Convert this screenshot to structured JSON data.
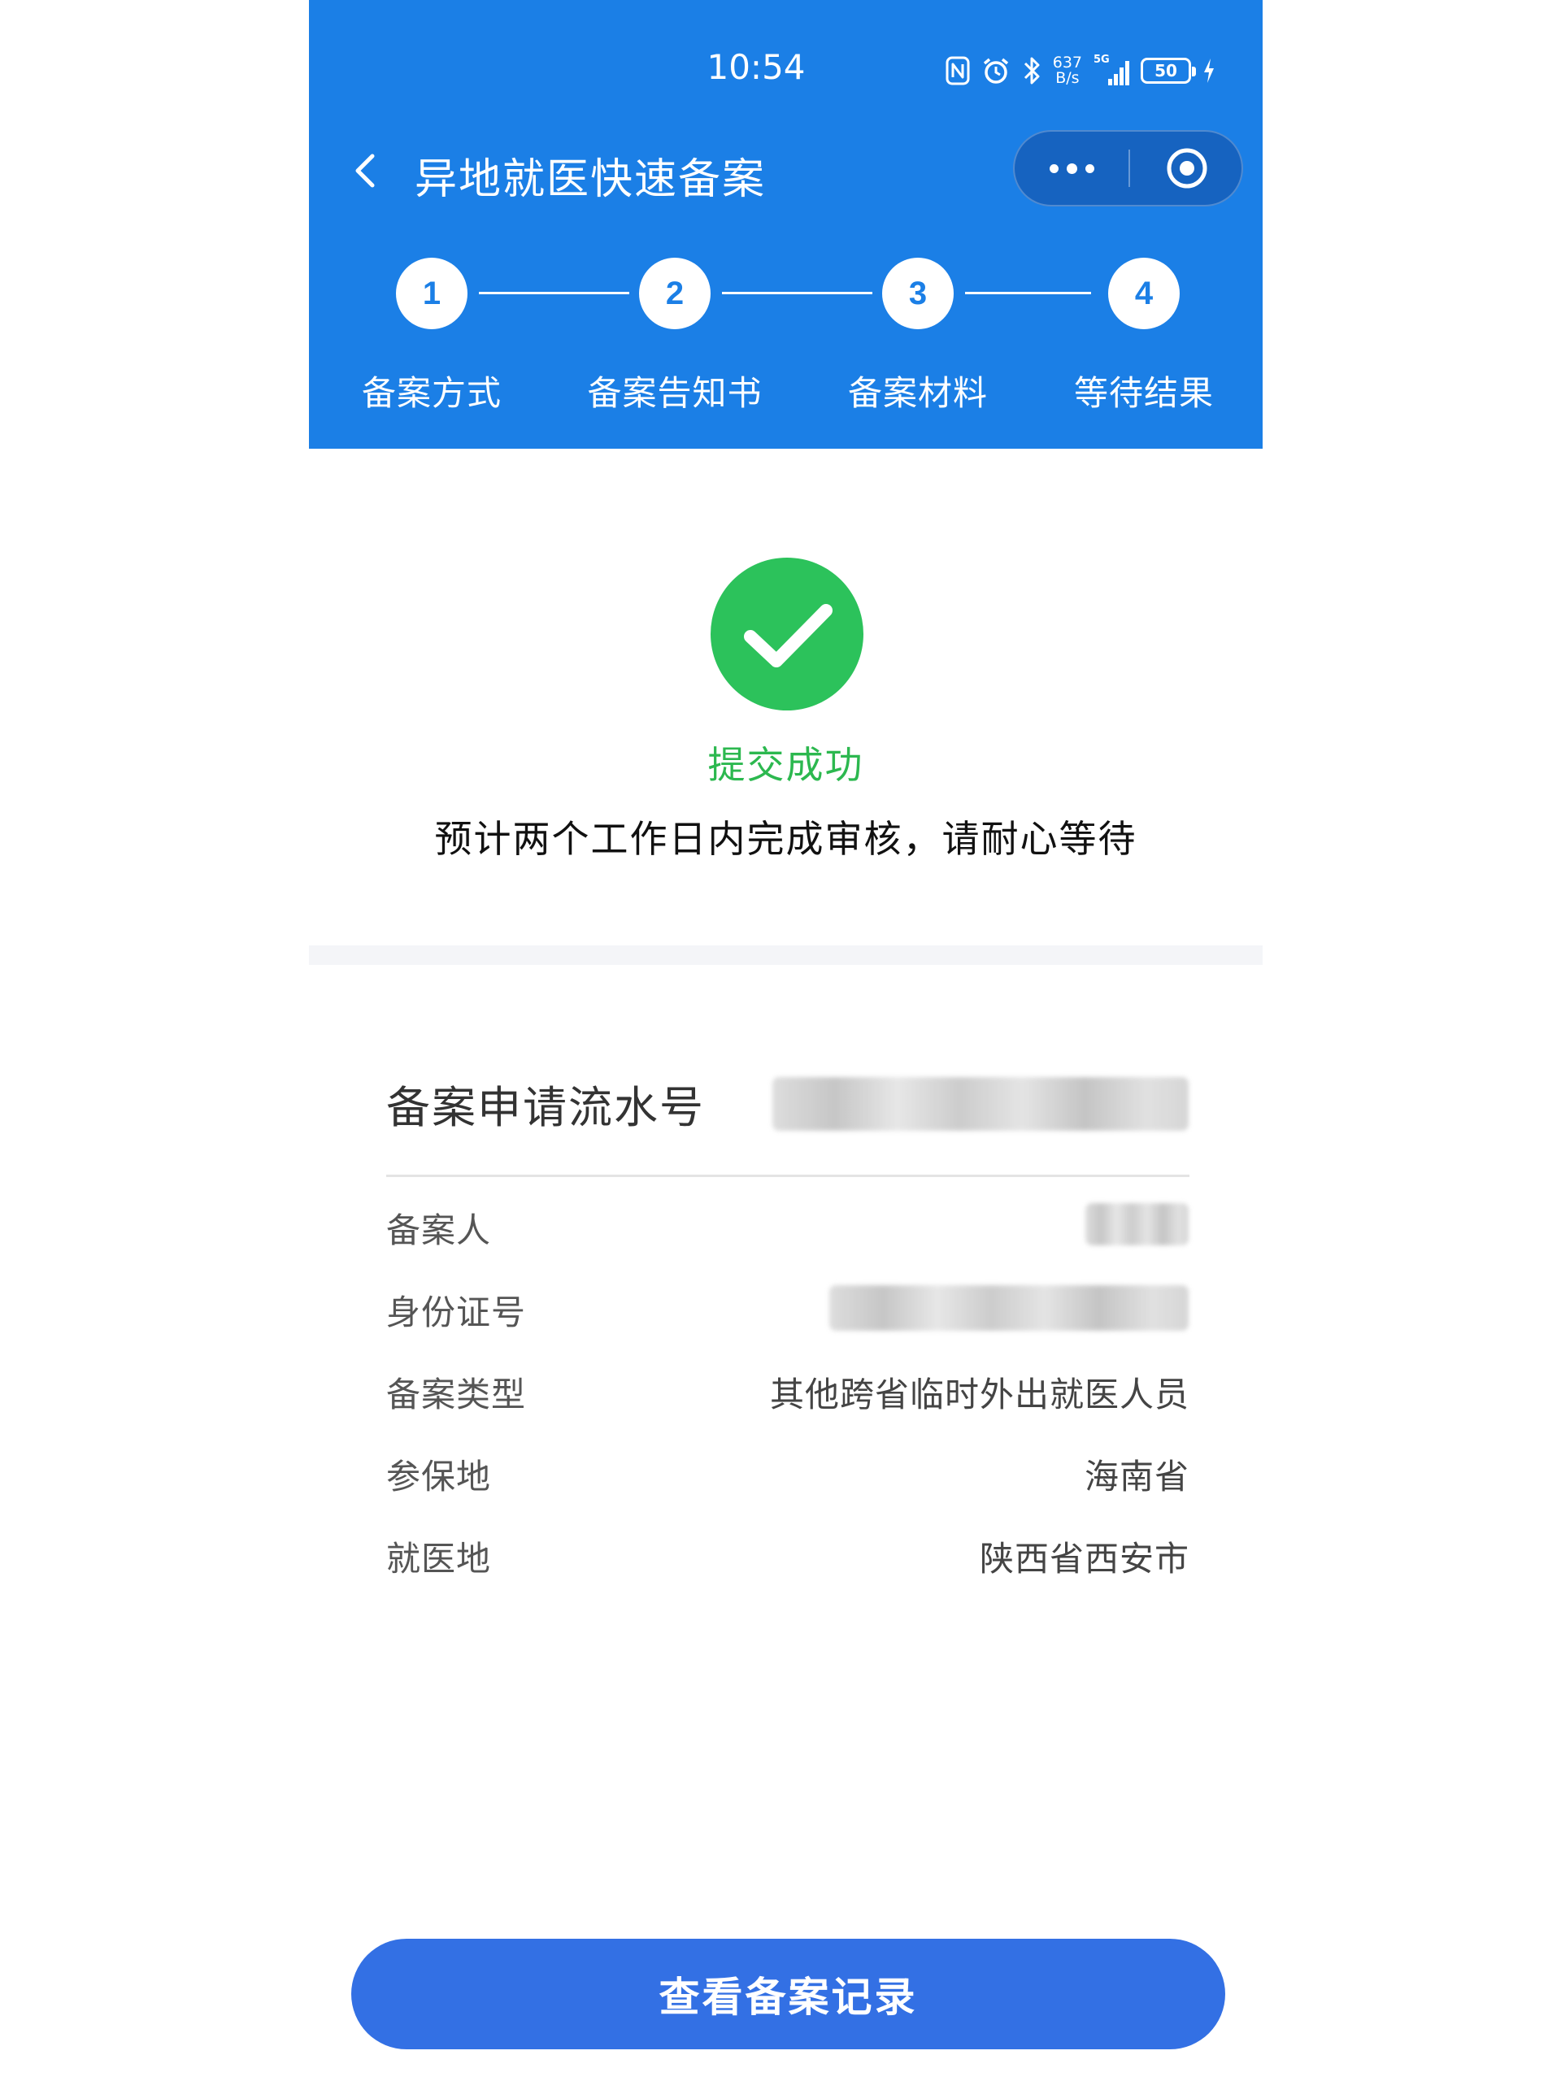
{
  "status_bar": {
    "time": "10:54",
    "net_speed_value": "637",
    "net_speed_unit": "B/s",
    "signal_label": "5G",
    "battery_level": "50"
  },
  "nav": {
    "title": "异地就医快速备案",
    "back_icon": "chevron-left-icon",
    "more_icon": "more-dots-icon",
    "close_icon": "target-circle-icon"
  },
  "steps": [
    {
      "number": "1",
      "label": "备案方式"
    },
    {
      "number": "2",
      "label": "备案告知书"
    },
    {
      "number": "3",
      "label": "备案材料"
    },
    {
      "number": "4",
      "label": "等待结果"
    }
  ],
  "result": {
    "icon": "check-circle-icon",
    "title": "提交成功",
    "description": "预计两个工作日内完成审核，请耐心等待"
  },
  "info": {
    "serial_label": "备案申请流水号",
    "rows": [
      {
        "label": "备案人",
        "value": ""
      },
      {
        "label": "身份证号",
        "value": ""
      },
      {
        "label": "备案类型",
        "value": "其他跨省临时外出就医人员"
      },
      {
        "label": "参保地",
        "value": "海南省"
      },
      {
        "label": "就医地",
        "value": "陕西省西安市"
      }
    ]
  },
  "actions": {
    "view_records_label": "查看备案记录"
  },
  "colors": {
    "header_blue": "#1b7fe6",
    "success_green": "#2cc25b",
    "button_blue": "#3370e4"
  }
}
